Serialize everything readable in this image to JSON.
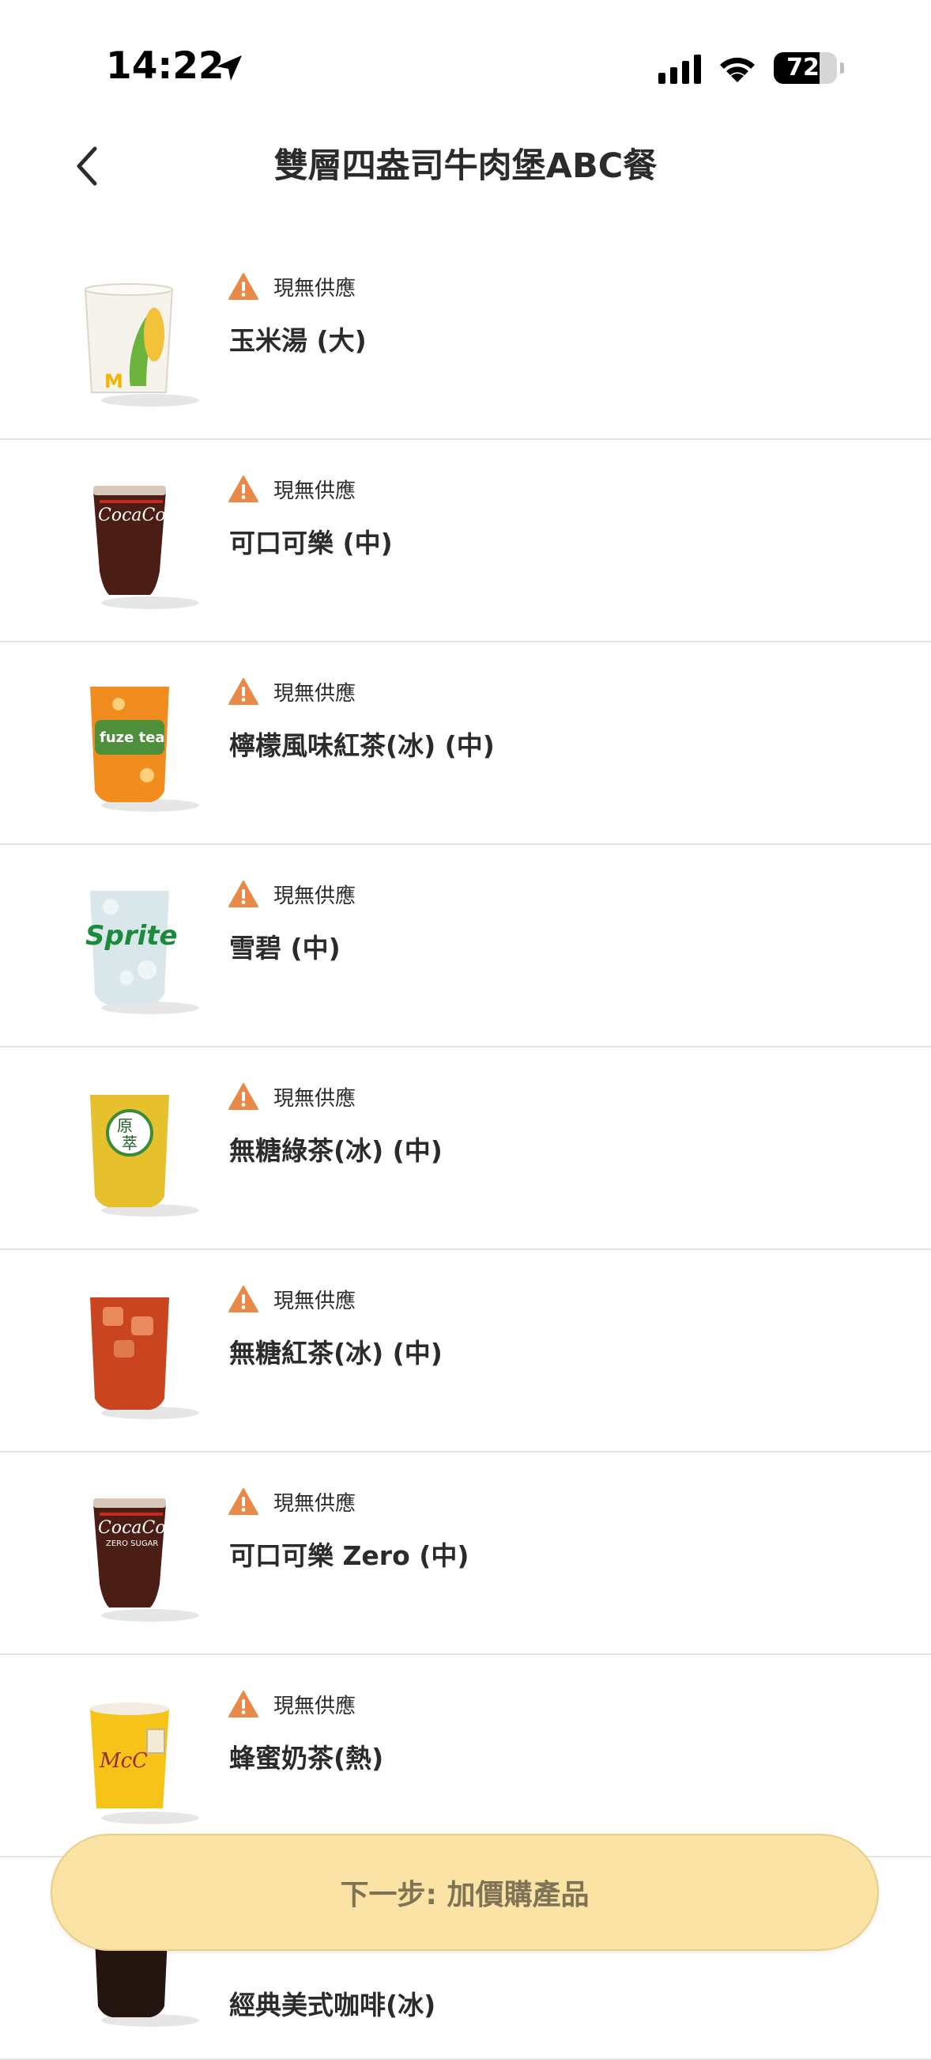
{
  "status_bar": {
    "time": "14:22",
    "battery": "72",
    "battery_level": 0.72
  },
  "header": {
    "title": "雙層四盎司牛肉堡ABC餐"
  },
  "items": [
    {
      "name": "玉米湯 (大)",
      "status": "現無供應",
      "image": "corn-soup"
    },
    {
      "name": "可口可樂 (中)",
      "status": "現無供應",
      "image": "coca-cola"
    },
    {
      "name": "檸檬風味紅茶(冰) (中)",
      "status": "現無供應",
      "image": "lemon-tea"
    },
    {
      "name": "雪碧 (中)",
      "status": "現無供應",
      "image": "sprite"
    },
    {
      "name": "無糖綠茶(冰) (中)",
      "status": "現無供應",
      "image": "green-tea"
    },
    {
      "name": "無糖紅茶(冰) (中)",
      "status": "現無供應",
      "image": "black-tea"
    },
    {
      "name": "可口可樂 Zero (中)",
      "status": "現無供應",
      "image": "coca-cola-zero"
    },
    {
      "name": "蜂蜜奶茶(熱)",
      "status": "現無供應",
      "image": "honey-milk-tea"
    },
    {
      "name": "經典美式咖啡(冰)",
      "status": "",
      "image": "iced-americano"
    }
  ],
  "footer": {
    "next_label": "下一步: 加價購產品"
  },
  "colors": {
    "warning": "#e8894a",
    "button_bg": "#fae3a5",
    "button_text": "#7f7355",
    "divider": "#e4e4e4"
  }
}
